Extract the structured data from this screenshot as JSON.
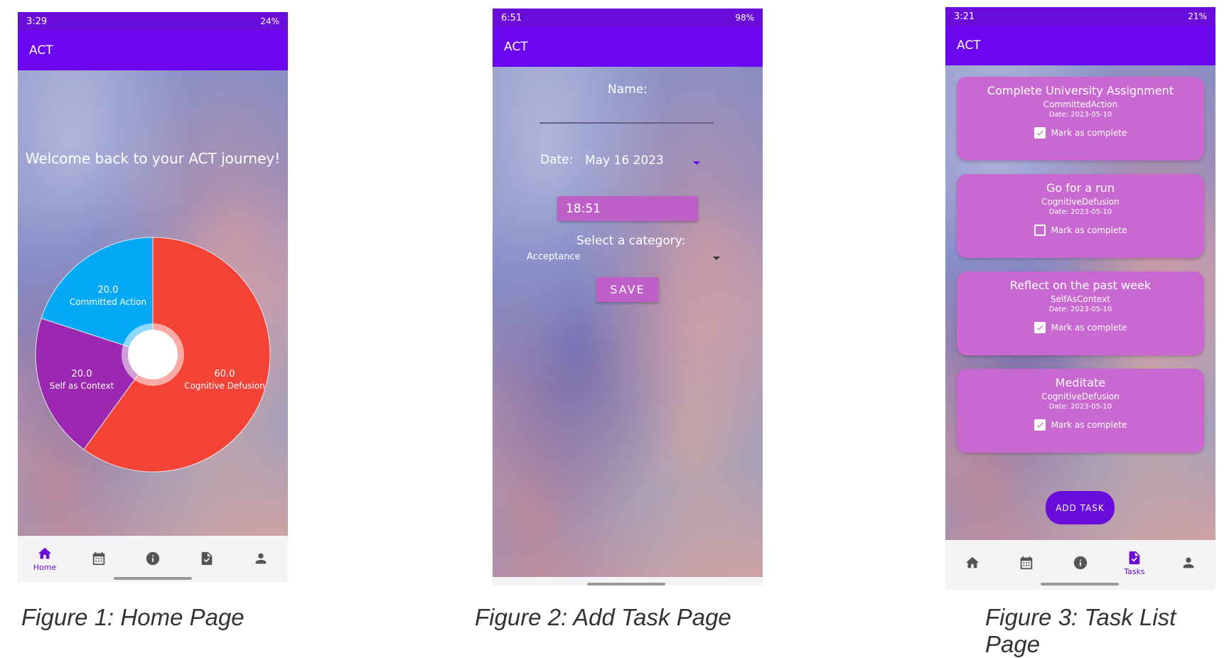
{
  "captions": {
    "fig1": "Figure 1: Home Page",
    "fig2": "Figure 2: Add Task Page",
    "fig3": "Figure 3: Task List Page"
  },
  "home": {
    "status": {
      "time": "3:29",
      "battery": "24%"
    },
    "app_title": "ACT",
    "welcome": "Welcome back to your ACT journey!",
    "nav_active_label": "Home",
    "chart_data": {
      "type": "pie",
      "style": "donut",
      "slices": [
        {
          "value": "60.0",
          "label": "Cognitive Defusion",
          "color": "#f44336"
        },
        {
          "value": "20.0",
          "label": "Self as Context",
          "color": "#9c27b0"
        },
        {
          "value": "20.0",
          "label": "Committed Action",
          "color": "#03a9f4"
        }
      ]
    }
  },
  "add_task": {
    "status": {
      "time": "6:51",
      "battery": "98%"
    },
    "app_title": "ACT",
    "name_label": "Name:",
    "name_value": "",
    "date_label": "Date:",
    "date_value": "May 16 2023",
    "time_value": "18:51",
    "category_label": "Select a category:",
    "category_value": "Acceptance",
    "save_label": "SAVE"
  },
  "task_list": {
    "status": {
      "time": "3:21",
      "battery": "21%"
    },
    "app_title": "ACT",
    "tasks": [
      {
        "title": "Complete University Assignment",
        "category": "CommittedAction",
        "date": "Date: 2023-05-10",
        "checkbox_label": "Mark as complete",
        "checked": true
      },
      {
        "title": "Go for a run",
        "category": "CognitiveDefusion",
        "date": "Date: 2023-05-10",
        "checkbox_label": "Mark as complete",
        "checked": false
      },
      {
        "title": "Reflect on the past week",
        "category": "SelfAsContext",
        "date": "Date: 2023-05-10",
        "checkbox_label": "Mark as complete",
        "checked": true
      },
      {
        "title": "Meditate",
        "category": "CognitiveDefusion",
        "date": "Date: 2023-05-10",
        "checkbox_label": "Mark as complete",
        "checked": true
      }
    ],
    "add_label": "ADD TASK",
    "nav_active_label": "Tasks"
  },
  "nav_icons": [
    "home-icon",
    "calendar-icon",
    "info-icon",
    "tasks-icon",
    "person-icon"
  ],
  "colors": {
    "primary": "#6b06f0",
    "card": "#c868d0"
  }
}
